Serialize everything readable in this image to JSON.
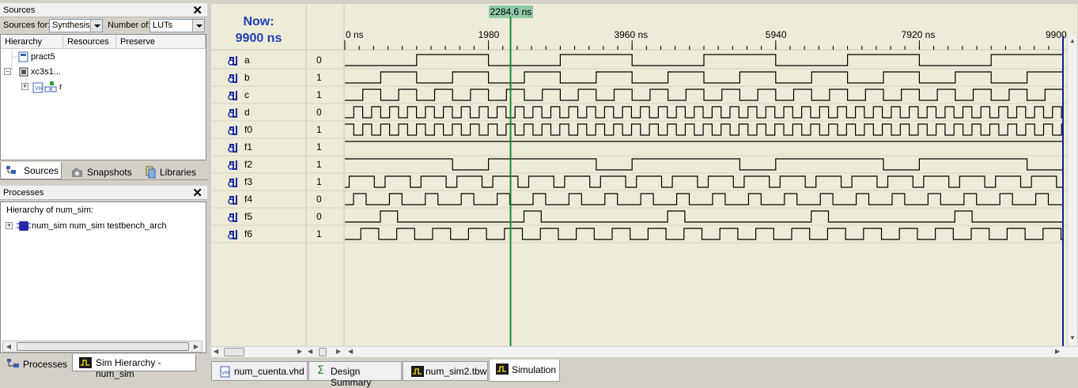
{
  "sources_panel": {
    "title": "Sources",
    "sources_for_label": "Sources for:",
    "sources_for_value": "Synthesis/",
    "number_of_label": "Number of:",
    "number_of_value": "LUTs",
    "columns": [
      "Hierarchy",
      "Resources",
      "Preserve"
    ],
    "tree": [
      {
        "label": "pract5"
      },
      {
        "label": "xc3s1..."
      },
      {
        "label": "r"
      }
    ],
    "tabs": [
      "Sources",
      "Snapshots",
      "Libraries"
    ]
  },
  "processes_panel": {
    "title": "Processes",
    "hierarchy_label": "Hierarchy of num_sim:",
    "item": "num_sim num_sim testbench_arch",
    "tabs": [
      "Processes",
      "Sim Hierarchy - num_sim"
    ]
  },
  "waveform": {
    "now_label": "Now:",
    "now_value": "9900 ns",
    "cursor_time": "2284.6 ns",
    "tick_labels": [
      "0 ns",
      "1980",
      "3960 ns",
      "5940",
      "7920 ns",
      "9900"
    ],
    "tick_times": [
      0,
      1980,
      3960,
      5940,
      7920,
      9900
    ],
    "time_start": 0,
    "time_end": 9900,
    "cursor_time_value": 2284.6,
    "signals": [
      {
        "name": "a",
        "value": "0",
        "period": 1980,
        "duty": 0.5,
        "offset": 990
      },
      {
        "name": "b",
        "value": "1",
        "period": 990,
        "duty": 0.5,
        "offset": 495
      },
      {
        "name": "c",
        "value": "1",
        "period": 495,
        "duty": 0.5,
        "offset": 247
      },
      {
        "name": "d",
        "value": "0",
        "period": 247,
        "duty": 0.5,
        "offset": 123
      },
      {
        "name": "f0",
        "value": "1",
        "period": 247,
        "duty": 0.5,
        "offset": 0
      },
      {
        "name": "f1",
        "value": "1",
        "constant": 1
      },
      {
        "name": "f2",
        "value": "1",
        "period": 1980,
        "duty": 0.75,
        "offset": 0
      },
      {
        "name": "f3",
        "value": "1",
        "period": 495,
        "duty": 0.7,
        "offset": 60
      },
      {
        "name": "f4",
        "value": "0",
        "period": 495,
        "duty": 0.35,
        "offset": 120
      },
      {
        "name": "f5",
        "value": "0",
        "period": 1980,
        "duty": 0.12,
        "offset": 490
      },
      {
        "name": "f6",
        "value": "1",
        "period": 495,
        "duty": 0.5,
        "offset": 220
      }
    ]
  },
  "bottom_tabs": [
    "num_cuenta.vhd",
    "Design Summary",
    "num_sim2.tbw",
    "Simulation"
  ],
  "colors": {
    "wave_bg": "#eeecd9",
    "cursor": "#1a8a3a",
    "now_text": "#1f3fb5",
    "end_marker": "#1a1aa0"
  }
}
